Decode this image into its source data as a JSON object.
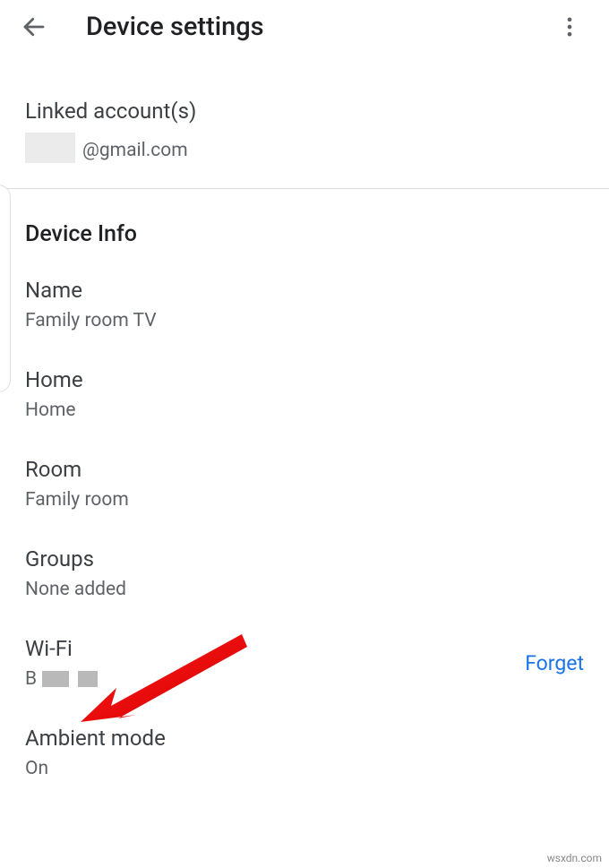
{
  "header": {
    "title": "Device settings"
  },
  "linked": {
    "section_label": "Linked account(s)",
    "email_domain": "@gmail.com"
  },
  "device_info": {
    "heading": "Device Info",
    "name": {
      "label": "Name",
      "value": "Family room TV"
    },
    "home": {
      "label": "Home",
      "value": "Home"
    },
    "room": {
      "label": "Room",
      "value": "Family room"
    },
    "groups": {
      "label": "Groups",
      "value": "None added"
    },
    "wifi": {
      "label": "Wi-Fi",
      "value_prefix": "B",
      "action": "Forget"
    },
    "ambient": {
      "label": "Ambient mode",
      "value": "On"
    }
  },
  "watermark": "wsxdn.com"
}
